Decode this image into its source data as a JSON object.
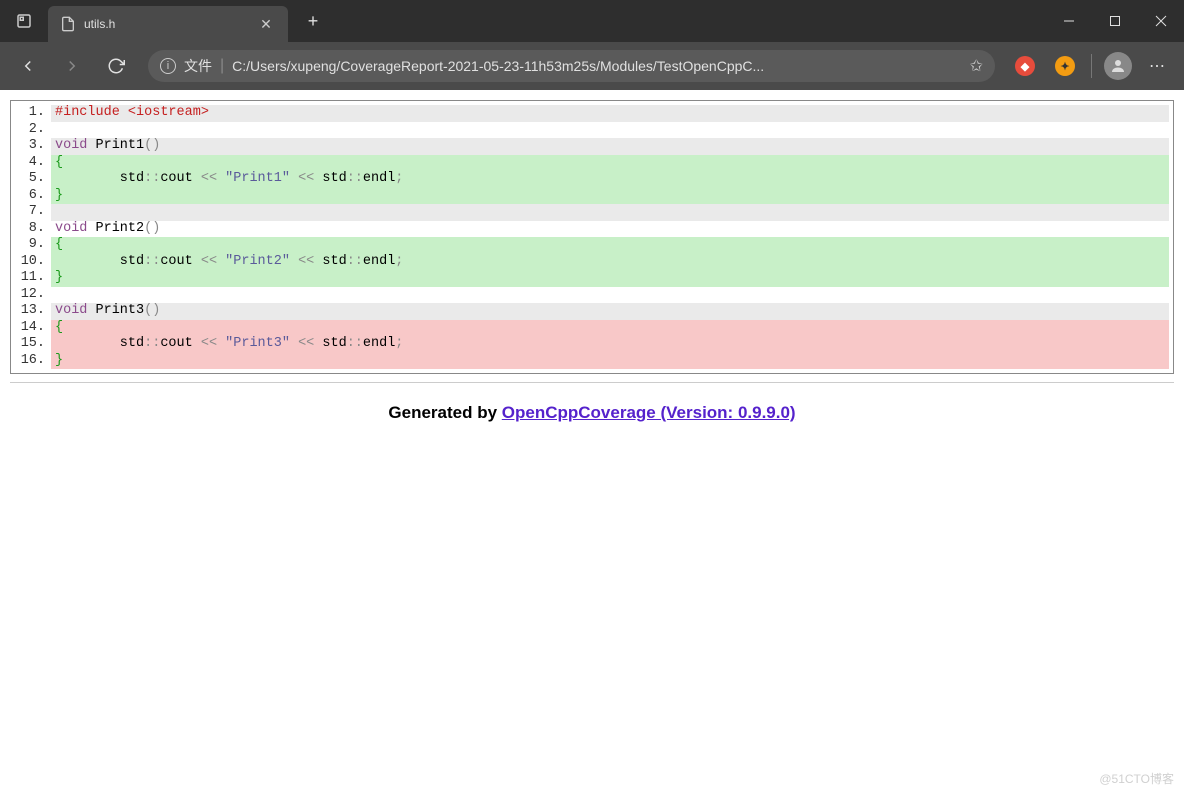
{
  "tab": {
    "title": "utils.h"
  },
  "address": {
    "label": "文件",
    "url": "C:/Users/xupeng/CoverageReport-2021-05-23-11h53m25s/Modules/TestOpenCppC..."
  },
  "code": {
    "lines": [
      {
        "n": "1.",
        "bg": "bg-gray",
        "tokens": [
          {
            "c": "c-preproc",
            "t": "#include <iostream>"
          }
        ]
      },
      {
        "n": "2.",
        "bg": "bg-white",
        "tokens": []
      },
      {
        "n": "3.",
        "bg": "bg-gray",
        "tokens": [
          {
            "c": "c-keyword",
            "t": "void"
          },
          {
            "c": "",
            "t": " Print1"
          },
          {
            "c": "c-punct",
            "t": "()"
          }
        ]
      },
      {
        "n": "4.",
        "bg": "bg-green",
        "tokens": [
          {
            "c": "c-brace",
            "t": "{"
          }
        ]
      },
      {
        "n": "5.",
        "bg": "bg-green",
        "tokens": [
          {
            "c": "",
            "t": "        std"
          },
          {
            "c": "c-punct",
            "t": "::"
          },
          {
            "c": "",
            "t": "cout "
          },
          {
            "c": "c-punct",
            "t": "<<"
          },
          {
            "c": "",
            "t": " "
          },
          {
            "c": "c-str",
            "t": "\"Print1\""
          },
          {
            "c": "",
            "t": " "
          },
          {
            "c": "c-punct",
            "t": "<<"
          },
          {
            "c": "",
            "t": " std"
          },
          {
            "c": "c-punct",
            "t": "::"
          },
          {
            "c": "",
            "t": "endl"
          },
          {
            "c": "c-punct",
            "t": ";"
          }
        ]
      },
      {
        "n": "6.",
        "bg": "bg-green",
        "tokens": [
          {
            "c": "c-brace",
            "t": "}"
          }
        ]
      },
      {
        "n": "7.",
        "bg": "bg-gray",
        "tokens": []
      },
      {
        "n": "8.",
        "bg": "bg-white",
        "tokens": [
          {
            "c": "c-keyword",
            "t": "void"
          },
          {
            "c": "",
            "t": " Print2"
          },
          {
            "c": "c-punct",
            "t": "()"
          }
        ]
      },
      {
        "n": "9.",
        "bg": "bg-green",
        "tokens": [
          {
            "c": "c-brace",
            "t": "{"
          }
        ]
      },
      {
        "n": "10.",
        "bg": "bg-green",
        "tokens": [
          {
            "c": "",
            "t": "        std"
          },
          {
            "c": "c-punct",
            "t": "::"
          },
          {
            "c": "",
            "t": "cout "
          },
          {
            "c": "c-punct",
            "t": "<<"
          },
          {
            "c": "",
            "t": " "
          },
          {
            "c": "c-str",
            "t": "\"Print2\""
          },
          {
            "c": "",
            "t": " "
          },
          {
            "c": "c-punct",
            "t": "<<"
          },
          {
            "c": "",
            "t": " std"
          },
          {
            "c": "c-punct",
            "t": "::"
          },
          {
            "c": "",
            "t": "endl"
          },
          {
            "c": "c-punct",
            "t": ";"
          }
        ]
      },
      {
        "n": "11.",
        "bg": "bg-green",
        "tokens": [
          {
            "c": "c-brace",
            "t": "}"
          }
        ]
      },
      {
        "n": "12.",
        "bg": "bg-white",
        "tokens": []
      },
      {
        "n": "13.",
        "bg": "bg-gray",
        "tokens": [
          {
            "c": "c-keyword",
            "t": "void"
          },
          {
            "c": "",
            "t": " Print3"
          },
          {
            "c": "c-punct",
            "t": "()"
          }
        ]
      },
      {
        "n": "14.",
        "bg": "bg-red",
        "tokens": [
          {
            "c": "c-brace",
            "t": "{"
          }
        ]
      },
      {
        "n": "15.",
        "bg": "bg-red",
        "tokens": [
          {
            "c": "",
            "t": "        std"
          },
          {
            "c": "c-punct",
            "t": "::"
          },
          {
            "c": "",
            "t": "cout "
          },
          {
            "c": "c-punct",
            "t": "<<"
          },
          {
            "c": "",
            "t": " "
          },
          {
            "c": "c-str",
            "t": "\"Print3\""
          },
          {
            "c": "",
            "t": " "
          },
          {
            "c": "c-punct",
            "t": "<<"
          },
          {
            "c": "",
            "t": " std"
          },
          {
            "c": "c-punct",
            "t": "::"
          },
          {
            "c": "",
            "t": "endl"
          },
          {
            "c": "c-punct",
            "t": ";"
          }
        ]
      },
      {
        "n": "16.",
        "bg": "bg-red",
        "tokens": [
          {
            "c": "c-brace",
            "t": "}"
          }
        ]
      }
    ]
  },
  "footer": {
    "label": "Generated by ",
    "link": "OpenCppCoverage (Version: 0.9.9.0)"
  },
  "watermark": "@51CTO博客"
}
